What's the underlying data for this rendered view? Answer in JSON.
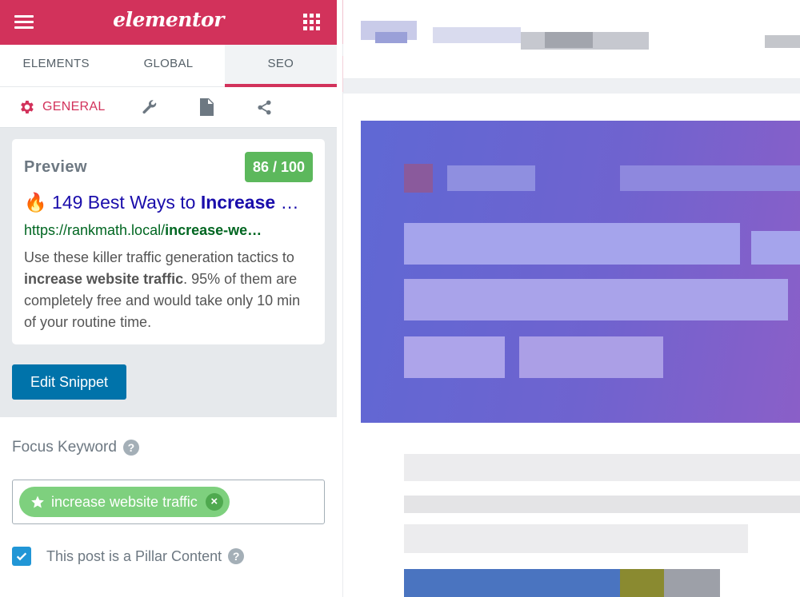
{
  "header": {
    "brand": "elementor"
  },
  "tabs": [
    {
      "label": "ELEMENTS",
      "active": false
    },
    {
      "label": "GLOBAL",
      "active": false
    },
    {
      "label": "SEO",
      "active": true
    }
  ],
  "subtabs": {
    "general_label": "GENERAL",
    "icons": [
      "gear-icon",
      "wrench-icon",
      "document-icon",
      "share-icon"
    ]
  },
  "preview": {
    "label": "Preview",
    "score": "86 / 100",
    "title_emoji": "🔥",
    "title_prefix": "149 Best Ways to ",
    "title_bold": "Increase",
    "title_suffix": " …",
    "url_prefix": "https://rankmath.local/",
    "url_bold": "increase-we…",
    "desc_1": "Use these killer traffic generation tactics to ",
    "desc_bold": "increase website traffic",
    "desc_2": ". 95% of them are completely free and would take only 10 min of your routine time."
  },
  "edit_snippet_label": "Edit Snippet",
  "focus_keyword": {
    "label": "Focus Keyword",
    "help": "?",
    "keyword": "increase website traffic",
    "remove": "×"
  },
  "pillar": {
    "label": "This post is a Pillar Content",
    "checked": true,
    "help": "?"
  },
  "colors": {
    "brand": "#d2325b",
    "score_good": "#5cb85c",
    "button_primary": "#0073aa",
    "keyword_chip": "#7ed07e"
  }
}
